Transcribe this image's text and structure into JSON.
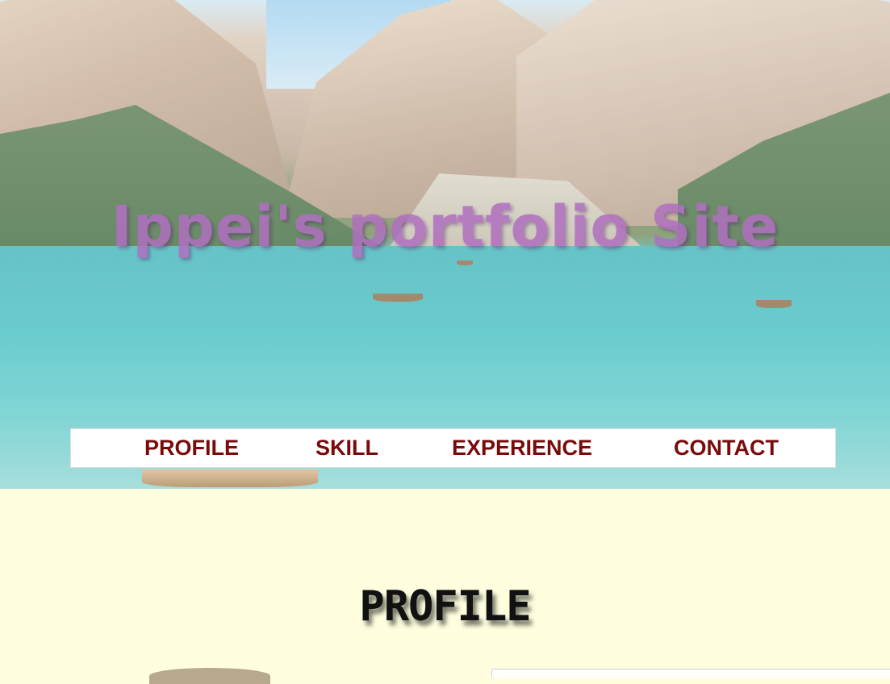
{
  "header": {
    "site_title": "Ippei's portfolio Site"
  },
  "nav": {
    "items": [
      {
        "label": "PROFILE"
      },
      {
        "label": "SKILL"
      },
      {
        "label": "EXPERIENCE"
      },
      {
        "label": "CONTACT"
      }
    ]
  },
  "profile_section": {
    "title": "PROFILE"
  },
  "colors": {
    "page_background": "#ffffe0",
    "nav_text": "#7a0a0a",
    "title_text": "#b06fc0"
  }
}
